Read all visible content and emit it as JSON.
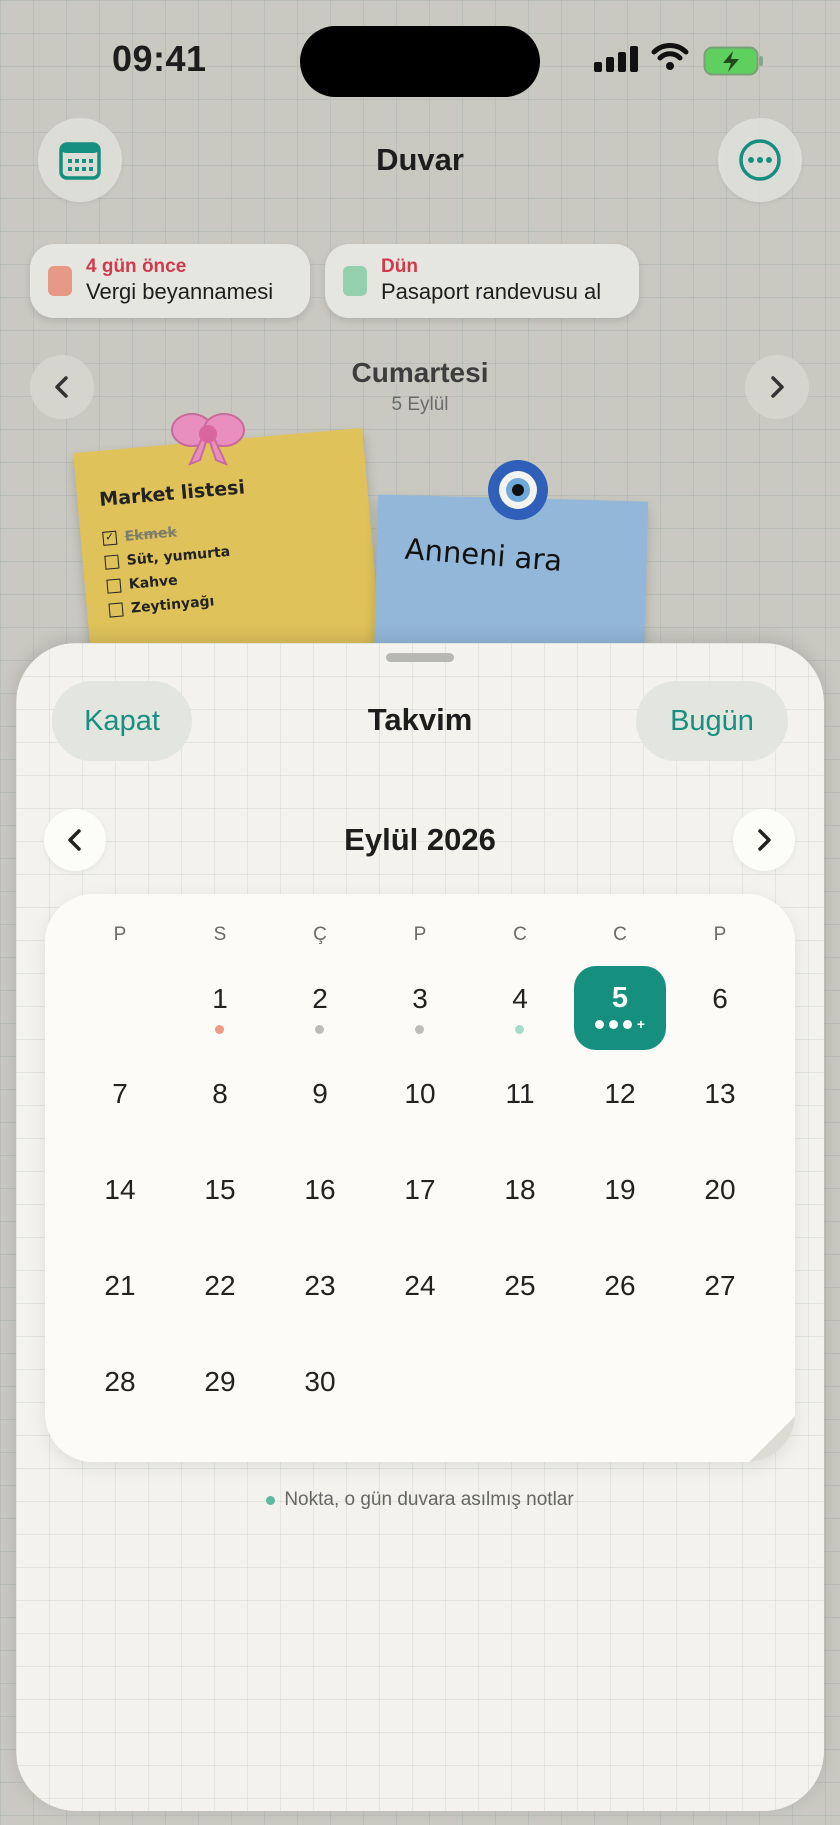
{
  "status_bar": {
    "time": "09:41"
  },
  "header": {
    "title": "Duvar",
    "left_icon": "calendar-grid-icon",
    "right_icon": "more-horizontal-icon"
  },
  "reminders": [
    {
      "when": "4 gün önce",
      "title": "Vergi beyannamesi",
      "color": "#e69a86"
    },
    {
      "when": "Dün",
      "title": "Pasaport randevusu al",
      "color": "#94cfae"
    }
  ],
  "day": {
    "name": "Cumartesi",
    "date": "5 Eylül"
  },
  "notes": {
    "market": {
      "title": "Market listesi",
      "items": [
        "Ekmek",
        "Süt, yumurta",
        "Kahve",
        "Zeytinyağı"
      ]
    },
    "reminder": {
      "title": "Anneni ara"
    }
  },
  "sheet": {
    "close": "Kapat",
    "title": "Takvim",
    "today": "Bugün"
  },
  "calendar": {
    "month": "Eylül 2026",
    "weekdays": [
      "P",
      "S",
      "Ç",
      "P",
      "C",
      "C",
      "P"
    ],
    "days": [
      "1",
      "2",
      "3",
      "4",
      "5",
      "6",
      "7",
      "8",
      "9",
      "10",
      "11",
      "12",
      "13",
      "14",
      "15",
      "16",
      "17",
      "18",
      "19",
      "20",
      "21",
      "22",
      "23",
      "24",
      "25",
      "26",
      "27",
      "28",
      "29",
      "30"
    ],
    "selected": "5",
    "selected_more": "+"
  },
  "legend": {
    "text": "Nokta, o gün duvara asılmış notlar"
  },
  "colors": {
    "accent": "#15907f",
    "alert": "#d03a4c"
  }
}
